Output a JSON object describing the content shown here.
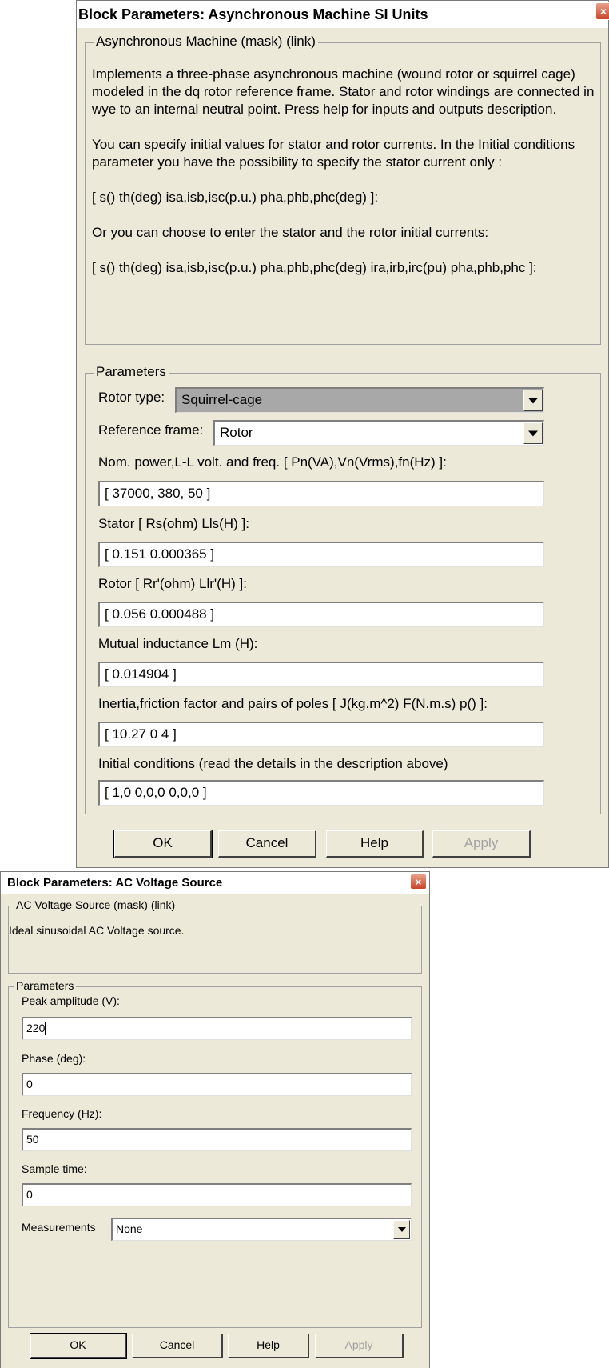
{
  "asynchronous_machine_dialog": {
    "title": "Block Parameters: Asynchronous Machine SI Units",
    "close_label": "×",
    "mask_group_title": "Asynchronous Machine (mask) (link)",
    "description": [
      "Implements a three-phase asynchronous machine (wound rotor or squirrel cage) modeled in the dq rotor reference frame. Stator and rotor windings are connected in wye to an internal neutral point. Press help for inputs and outputs description.",
      "You can specify initial  values for stator and rotor currents. In the Initial conditions parameter you have the possibility to specify the stator current only :",
      "[ s() th(deg)  isa,isb,isc(p.u.)  pha,phb,phc(deg) ]:",
      "Or you can choose to enter the stator and the rotor initial currents:",
      "[ s() th(deg)  isa,isb,isc(p.u.)  pha,phb,phc(deg) ira,irb,irc(pu)  pha,phb,phc ]:"
    ],
    "parameters_group_title": "Parameters",
    "rotor_type": {
      "label": "Rotor type:",
      "value": "Squirrel-cage"
    },
    "reference_frame": {
      "label": "Reference frame:",
      "value": "Rotor"
    },
    "nominal": {
      "label": "Nom. power,L-L volt. and freq. [ Pn(VA),Vn(Vrms),fn(Hz) ]:",
      "value": "[ 37000, 380, 50 ]"
    },
    "stator": {
      "label": "Stator [ Rs(ohm)  Lls(H) ]:",
      "value": "[ 0.151  0.000365 ]"
    },
    "rotor": {
      "label": "Rotor [ Rr'(ohm)  Llr'(H) ]:",
      "value": "[ 0.056  0.000488 ]"
    },
    "mutual": {
      "label": "Mutual inductance Lm (H):",
      "value": "[ 0.014904 ]"
    },
    "inertia": {
      "label": "Inertia,friction factor and pairs of poles [ J(kg.m^2)  F(N.m.s)  p() ]:",
      "value": "[ 10.27  0  4 ]"
    },
    "initial": {
      "label": "Initial conditions  (read the details in the description above)",
      "value": "[ 1,0   0,0,0   0,0,0 ]"
    },
    "buttons": {
      "ok": "OK",
      "cancel": "Cancel",
      "help": "Help",
      "apply": "Apply"
    }
  },
  "ac_voltage_dialog": {
    "title": "Block Parameters: AC Voltage Source",
    "close_label": "×",
    "mask_group_title": "AC Voltage Source (mask) (link)",
    "description": "Ideal sinusoidal AC Voltage source.",
    "parameters_group_title": "Parameters",
    "peak": {
      "label": "Peak amplitude (V):",
      "value": "220"
    },
    "phase": {
      "label": "Phase (deg):",
      "value": "0"
    },
    "frequency": {
      "label": "Frequency (Hz):",
      "value": "50"
    },
    "sample_time": {
      "label": "Sample time:",
      "value": "0"
    },
    "measurements": {
      "label": "Measurements",
      "value": "None"
    },
    "buttons": {
      "ok": "OK",
      "cancel": "Cancel",
      "help": "Help",
      "apply": "Apply"
    }
  },
  "colors": {
    "dialog_background": "#ece9d8",
    "selected_dropdown": "#a8a8a8",
    "close_button": "#c8462a",
    "disabled_text": "#a0a0a0"
  }
}
